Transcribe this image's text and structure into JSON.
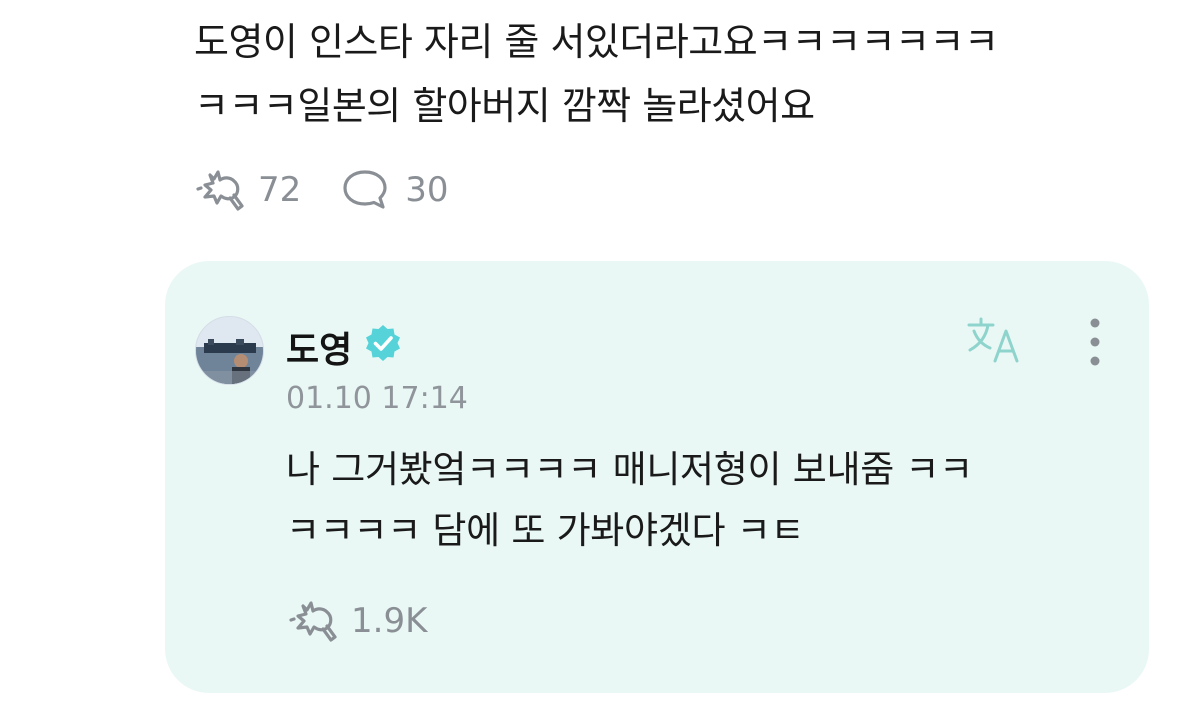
{
  "post": {
    "text_line1": "도영이 인스타 자리 줄 서있더라고요ㅋㅋㅋㅋㅋㅋㅋ",
    "text_line2": "ㅋㅋㅋ일본의 할아버지 깜짝 놀라셨어요",
    "like_count": "72",
    "comment_count": "30"
  },
  "reply": {
    "author": "도영",
    "timestamp": "01.10 17:14",
    "text_line1": "나 그거봤엌ㅋㅋㅋㅋ 매니저형이 보내줌 ㅋㅋ",
    "text_line2": "ㅋㅋㅋㅋ 담에 또 가봐야겠다 ㅋㅌ",
    "like_count": "1.9K"
  },
  "icons": {
    "like": "like-icon",
    "comment": "comment-icon",
    "verified": "verified-badge-icon",
    "translate": "translate-icon",
    "more": "more-vertical-icon"
  },
  "colors": {
    "card_bg": "#e9f8f5",
    "verified": "#56d3d8",
    "muted": "#8a8f95"
  }
}
